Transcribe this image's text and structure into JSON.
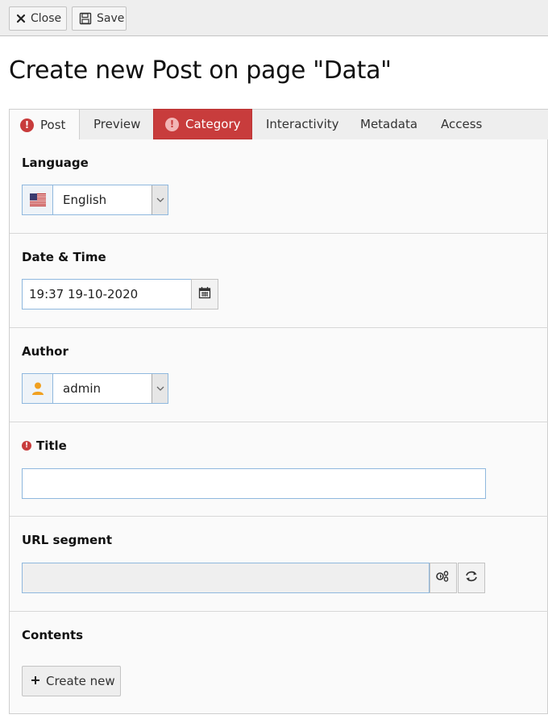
{
  "toolbar": {
    "close_label": "Close",
    "save_label": "Save"
  },
  "page": {
    "title": "Create new Post on page \"Data\""
  },
  "tabs": [
    {
      "label": "Post",
      "state": "active",
      "has_error": true
    },
    {
      "label": "Preview",
      "state": "normal",
      "has_error": false
    },
    {
      "label": "Category",
      "state": "error",
      "has_error": true
    },
    {
      "label": "Interactivity",
      "state": "normal",
      "has_error": false
    },
    {
      "label": "Metadata",
      "state": "normal",
      "has_error": false
    },
    {
      "label": "Access",
      "state": "normal",
      "has_error": false
    }
  ],
  "fields": {
    "language": {
      "label": "Language",
      "value": "English",
      "icon": "us-flag-icon"
    },
    "datetime": {
      "label": "Date & Time",
      "value": "19:37 19-10-2020",
      "icon": "calendar-icon"
    },
    "author": {
      "label": "Author",
      "value": "admin",
      "icon": "user-icon"
    },
    "title": {
      "label": "Title",
      "value": "",
      "required_error": true
    },
    "url_segment": {
      "label": "URL segment",
      "value": ""
    },
    "contents": {
      "label": "Contents",
      "button_label": "Create new"
    }
  },
  "colors": {
    "error": "#c83c3c",
    "input_border": "#8fb8de",
    "panel_bg": "#fafafa"
  }
}
